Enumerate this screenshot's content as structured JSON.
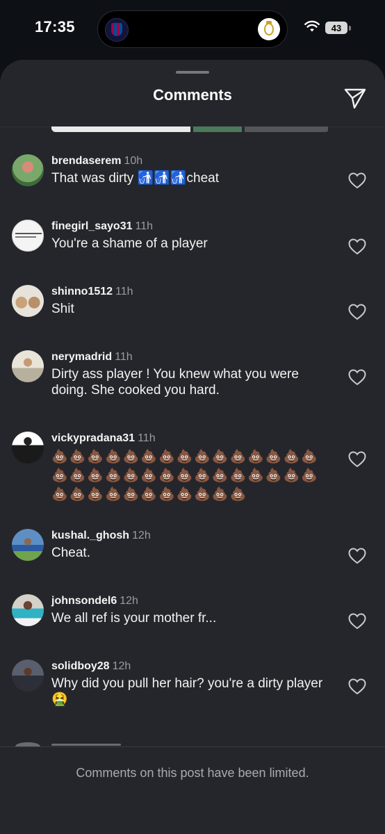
{
  "status_bar": {
    "time": "17:35",
    "battery": "43"
  },
  "sheet": {
    "title": "Comments",
    "limited_notice": "Comments on this post have been limited."
  },
  "comments": [
    {
      "username": "brendaserem",
      "time": "10h",
      "text": "That was dirty 🚮🚮🚮cheat"
    },
    {
      "username": "finegirl_sayo31",
      "time": "11h",
      "text": "You're a shame of a player"
    },
    {
      "username": "shinno1512",
      "time": "11h",
      "text": "Shit"
    },
    {
      "username": "nerymadrid",
      "time": "11h",
      "text": "Dirty ass player ! You knew what you were doing. She cooked you hard."
    },
    {
      "username": "vickypradana31",
      "time": "11h",
      "text": "💩💩💩💩💩💩💩💩💩💩💩💩💩💩💩💩💩💩💩💩💩💩💩💩💩💩💩💩💩💩💩💩💩💩💩💩💩💩💩💩💩"
    },
    {
      "username": "kushal._ghosh",
      "time": "12h",
      "text": "Cheat."
    },
    {
      "username": "johnsondel6",
      "time": "12h",
      "text": "We all ref is your mother fr..."
    },
    {
      "username": "solidboy28",
      "time": "12h",
      "text": "Why did you pull her hair? you're a dirty player 🤮"
    }
  ],
  "icons": {
    "share": "paper-plane-icon",
    "like": "heart-outline-icon",
    "wifi": "wifi-icon"
  }
}
